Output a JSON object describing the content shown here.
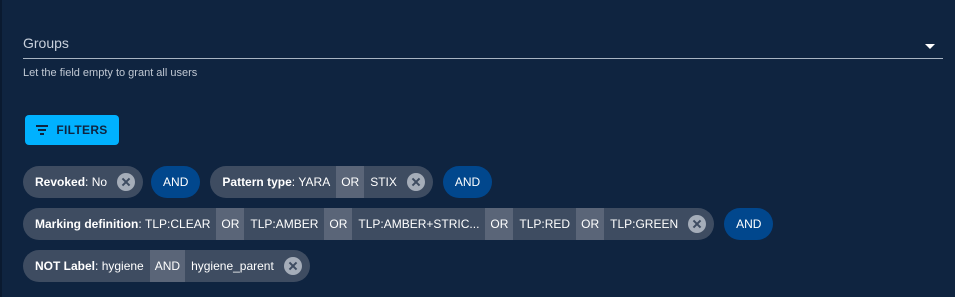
{
  "groups_field": {
    "label": "Groups",
    "helper": "Let the field empty to grant all users"
  },
  "filters_button": {
    "label": "FILTERS",
    "icon": "filter-list-icon"
  },
  "filters": [
    {
      "key": "Revoked",
      "values": [
        "No"
      ],
      "operators": []
    },
    {
      "key": "Pattern type",
      "values": [
        "YARA",
        "STIX"
      ],
      "operators": [
        "OR"
      ]
    },
    {
      "key": "Marking definition",
      "values": [
        "TLP:CLEAR",
        "TLP:AMBER",
        "TLP:AMBER+STRIC...",
        "TLP:RED",
        "TLP:GREEN"
      ],
      "operators": [
        "OR",
        "OR",
        "OR",
        "OR"
      ]
    },
    {
      "key": "NOT Label",
      "values": [
        "hygiene",
        "hygiene_parent"
      ],
      "operators": [
        "AND"
      ]
    }
  ],
  "and_label": "AND",
  "colors": {
    "background": "#0f2440",
    "accent": "#00b1ff",
    "chip": "#3e4c61",
    "and_chip": "#01478d"
  }
}
